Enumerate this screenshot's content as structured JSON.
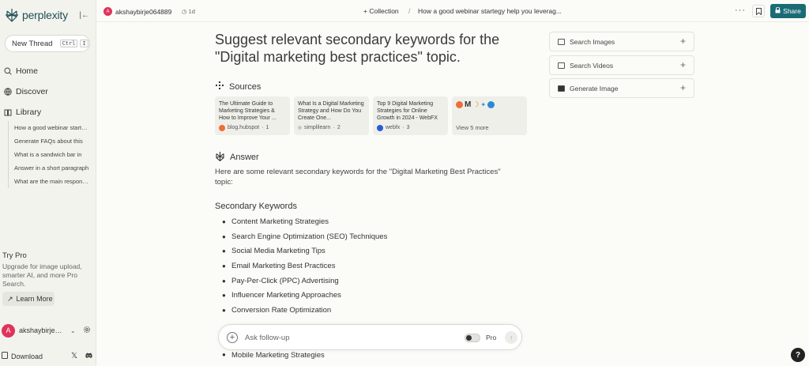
{
  "sidebar": {
    "logo_text": "perplexity",
    "new_thread_label": "New Thread",
    "shortcut_keys": [
      "Ctrl",
      "I"
    ],
    "nav": [
      {
        "label": "Home",
        "icon": "search-icon"
      },
      {
        "label": "Discover",
        "icon": "globe-icon"
      },
      {
        "label": "Library",
        "icon": "library-icon"
      }
    ],
    "library_items": [
      "How a good webinar startegy help you leverage",
      "Generate FAQs about this",
      "What is a sandwich bar in",
      "Answer in a short paragraph",
      "What are the main responsibilities"
    ],
    "try_pro_title": "Try Pro",
    "try_pro_desc": "Upgrade for image upload, smarter AI, and more Pro Search.",
    "learn_more_label": "Learn More",
    "user_initial": "A",
    "user_name": "akshaybirje064889",
    "download_label": "Download"
  },
  "topbar": {
    "user_initial": "A",
    "user_name": "akshaybirje064889",
    "time": "1d",
    "collection_label": "+ Collection",
    "separator": "/",
    "thread_title": "How a good webinar startegy help you leverag...",
    "more": "···",
    "share_label": "Share"
  },
  "main": {
    "question": "Suggest relevant secondary keywords for the \"Digital marketing best practices\" topic.",
    "sources_heading": "Sources",
    "sources": [
      {
        "title": "The Ultimate Guide to Marketing Strategies & How to Improve Your ...",
        "site": "blog.hubspot",
        "num": "1",
        "color": "#f26b3a"
      },
      {
        "title": "What Is a Digital Marketing Strategy and How Do You Create One...",
        "site": "simplilearn",
        "num": "2",
        "color": "#c9c9c4"
      },
      {
        "title": "Top 9 Digital Marketing Strategies for Online Growth in 2024 - WebFX",
        "site": "webfx",
        "num": "3",
        "color": "#2a5bd7"
      }
    ],
    "view_more_label": "View 5 more",
    "answer_heading": "Answer",
    "answer_intro": "Here are some relevant secondary keywords for the \"Digital Marketing Best Practices\" topic:",
    "keywords_title": "Secondary Keywords",
    "keywords": [
      "Content Marketing Strategies",
      "Search Engine Optimization (SEO) Techniques",
      "Social Media Marketing Tips",
      "Email Marketing Best Practices",
      "Pay-Per-Click (PPC) Advertising",
      "Influencer Marketing Approaches",
      "Conversion Rate Optimization"
    ],
    "partial_keyword": "Mobile Marketing Strategies"
  },
  "rail": [
    {
      "label": "Search Images",
      "icon": "image-icon"
    },
    {
      "label": "Search Videos",
      "icon": "video-icon"
    },
    {
      "label": "Generate Image",
      "icon": "pro-image-icon"
    }
  ],
  "followup": {
    "placeholder": "Ask follow-up",
    "pro_label": "Pro"
  },
  "help_label": "?",
  "colors": {
    "accent": "#1a6b74",
    "avatar": "#e0335a",
    "background": "#fbfbf8",
    "sidebar": "#f3f3ee"
  }
}
